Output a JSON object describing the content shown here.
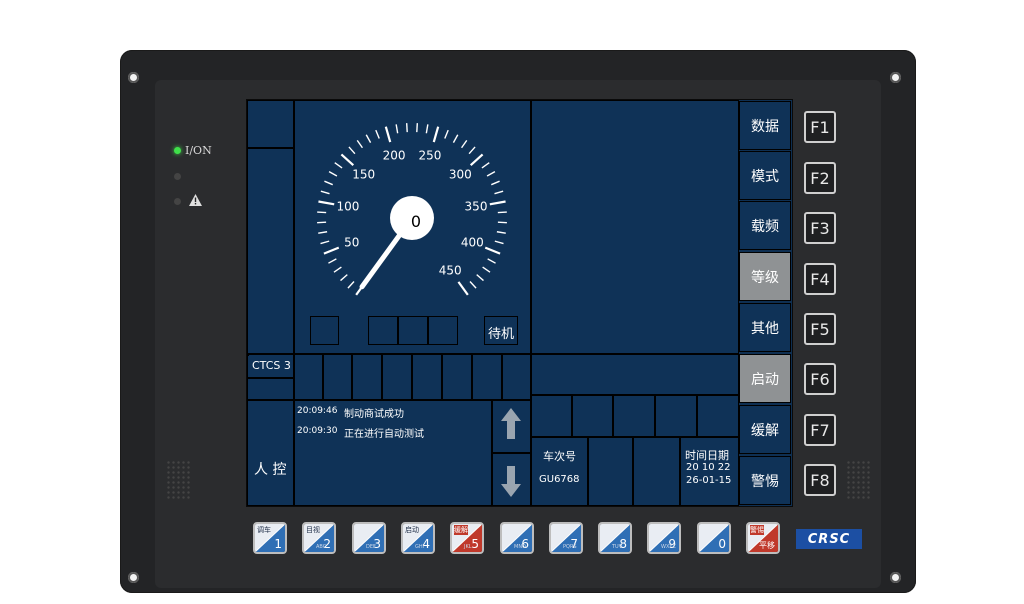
{
  "device": {
    "power_label": "I/ON",
    "logo": "CRSC"
  },
  "speedometer": {
    "current_speed": "0",
    "tick_labels": [
      "50",
      "100",
      "150",
      "200",
      "250",
      "300",
      "350",
      "400",
      "450"
    ]
  },
  "status": {
    "mode_text": "待机",
    "ctcs_level": "CTCS 3",
    "control_mode": "人 控"
  },
  "messages": [
    {
      "time": "20:09:46",
      "text": "制动商试成功"
    },
    {
      "time": "20:09:30",
      "text": "正在进行自动测试"
    }
  ],
  "train": {
    "number_label": "车次号",
    "number": "GU6768",
    "datetime_label": "时间日期",
    "time": "20 10 22",
    "date": "26-01-15"
  },
  "menu": [
    {
      "label": "数据",
      "active": false
    },
    {
      "label": "模式",
      "active": false
    },
    {
      "label": "载频",
      "active": false
    },
    {
      "label": "等级",
      "active": true
    },
    {
      "label": "其他",
      "active": false
    },
    {
      "label": "启动",
      "active": true
    },
    {
      "label": "缓解",
      "active": false
    },
    {
      "label": "警惕",
      "active": false
    }
  ],
  "function_keys": [
    "F1",
    "F2",
    "F3",
    "F4",
    "F5",
    "F6",
    "F7",
    "F8"
  ],
  "number_keys": [
    {
      "num": "1",
      "label": "调车",
      "sub": "",
      "red": false
    },
    {
      "num": "2",
      "label": "目视",
      "sub": "ABC",
      "red": false
    },
    {
      "num": "3",
      "label": "",
      "sub": "DEF",
      "red": false
    },
    {
      "num": "4",
      "label": "启动",
      "sub": "GHI",
      "red": false
    },
    {
      "num": "5",
      "label": "缓解",
      "sub": "JKL",
      "red": true
    },
    {
      "num": "6",
      "label": "",
      "sub": "MNO",
      "red": false
    },
    {
      "num": "7",
      "label": "",
      "sub": "PQRS",
      "red": false
    },
    {
      "num": "8",
      "label": "",
      "sub": "TUV",
      "red": false
    },
    {
      "num": "9",
      "label": "",
      "sub": "WXYZ",
      "red": false
    },
    {
      "num": "0",
      "label": "",
      "sub": "",
      "red": false
    },
    {
      "num": "平移",
      "label": "警惕",
      "sub": "",
      "red": true
    }
  ],
  "colors": {
    "screen_bg": "#0e2f52",
    "active_menu": "#8f9294",
    "key_blue": "#2f6fb5",
    "key_red": "#c0392b",
    "led_on": "#3fe04a"
  }
}
